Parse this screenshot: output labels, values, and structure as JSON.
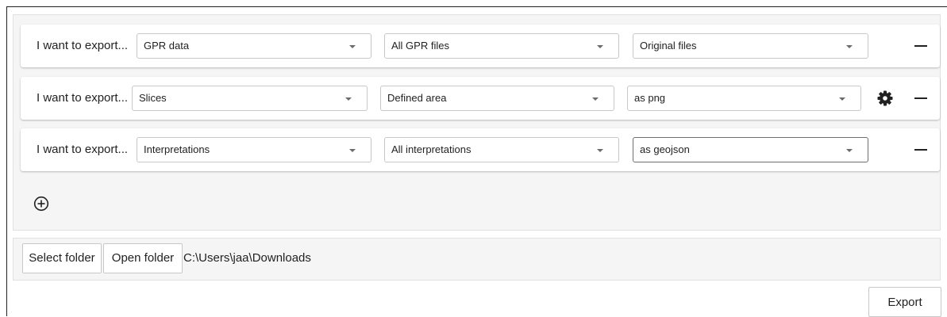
{
  "export_rows": [
    {
      "label": "I want to export...",
      "type": "GPR data",
      "scope": "All GPR files",
      "format": "Original files",
      "has_settings": false
    },
    {
      "label": "I want to export...",
      "type": "Slices",
      "scope": "Defined area",
      "format": "as png",
      "has_settings": true
    },
    {
      "label": "I want to export...",
      "type": "Interpretations",
      "scope": "All interpretations",
      "format": "as geojson",
      "has_settings": false
    }
  ],
  "icons": {
    "remove": "minus-icon",
    "settings": "gear-icon",
    "add": "plus-circle-icon",
    "dropdown": "caret-down-icon"
  },
  "folder": {
    "select_label": "Select folder",
    "open_label": "Open folder",
    "path": "C:\\Users\\jaa\\Downloads"
  },
  "footer": {
    "export_label": "Export"
  }
}
